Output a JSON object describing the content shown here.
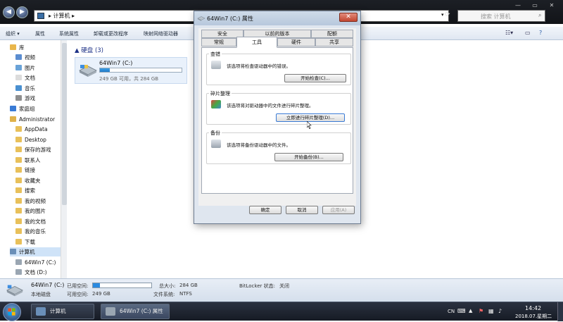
{
  "explorer": {
    "address": "▸ 计算机 ▸",
    "search_placeholder": "搜索 计算机",
    "toolbar": [
      "组织 ▾",
      "属性",
      "系统属性",
      "卸载或更改程序",
      "映射网络驱动器"
    ],
    "nav_items": [
      {
        "label": "库",
        "icon": "library-icon",
        "color": "#e9b64b"
      },
      {
        "label": "视频",
        "icon": "video-icon",
        "color": "#5b8dd0"
      },
      {
        "label": "图片",
        "icon": "picture-icon",
        "color": "#6aa3d8"
      },
      {
        "label": "文档",
        "icon": "document-icon",
        "color": "#dcdcdc"
      },
      {
        "label": "音乐",
        "icon": "music-icon",
        "color": "#4a90d0"
      },
      {
        "label": "游戏",
        "icon": "games-icon",
        "color": "#8f8f8f"
      },
      {
        "label": "家庭组",
        "icon": "homegroup-icon",
        "color": "#3a7bd5"
      },
      {
        "label": "Administrator",
        "icon": "user-folder-icon",
        "color": "#e0b24a"
      },
      {
        "label": "AppData",
        "icon": "folder-icon",
        "color": "#e8c05a"
      },
      {
        "label": "Desktop",
        "icon": "folder-icon",
        "color": "#e8c05a"
      },
      {
        "label": "保存的游戏",
        "icon": "folder-icon",
        "color": "#e8c05a"
      },
      {
        "label": "联系人",
        "icon": "folder-icon",
        "color": "#e8c05a"
      },
      {
        "label": "链接",
        "icon": "folder-icon",
        "color": "#e8c05a"
      },
      {
        "label": "收藏夹",
        "icon": "folder-icon",
        "color": "#e8c05a"
      },
      {
        "label": "搜索",
        "icon": "folder-icon",
        "color": "#e8c05a"
      },
      {
        "label": "我的视频",
        "icon": "folder-icon",
        "color": "#e8c05a"
      },
      {
        "label": "我的图片",
        "icon": "folder-icon",
        "color": "#e8c05a"
      },
      {
        "label": "我的文档",
        "icon": "folder-icon",
        "color": "#e8c05a"
      },
      {
        "label": "我的音乐",
        "icon": "folder-icon",
        "color": "#e8c05a"
      },
      {
        "label": "下载",
        "icon": "folder-icon",
        "color": "#e8c05a"
      },
      {
        "label": "计算机",
        "icon": "computer-icon",
        "color": "#6a8fb8"
      },
      {
        "label": "64Win7  (C:)",
        "icon": "drive-icon",
        "color": "#9aa6b2"
      },
      {
        "label": "文档 (D:)",
        "icon": "drive-icon",
        "color": "#9aa6b2"
      }
    ],
    "group_title": "▲ 硬盘 (3)",
    "drive": {
      "name": "64Win7  (C:)",
      "space": "249 GB 可用，共 284 GB",
      "used_fraction": 0.12
    },
    "details": {
      "name": "64Win7  (C:)",
      "used_label": "已用空间:",
      "free_label": "可用空间:",
      "free": "249 GB",
      "type": "本地磁盘",
      "total_label": "总大小:",
      "total": "284 GB",
      "fs_label": "文件系统:",
      "fs": "NTFS",
      "bitlocker_label": "BitLocker 状态:",
      "bitlocker": "关闭",
      "used_fraction": 0.12
    }
  },
  "taskbar": {
    "items": [
      "计算机",
      "64Win7  (C:) 属性"
    ],
    "lang": "CN",
    "time": "14:42",
    "date": "2018.07.星期二"
  },
  "dialog": {
    "title": "64Win7 (C:) 属性",
    "close": "✕",
    "tabs_row1": [
      "安全",
      "以前的版本",
      "配额"
    ],
    "tabs_row2": [
      "常规",
      "工具",
      "硬件",
      "共享"
    ],
    "active_tab": "工具",
    "groups": [
      {
        "label": "查错",
        "text": "该选项将检查驱动器中的错误。",
        "button": "开始检查(C)..."
      },
      {
        "label": "碎片整理",
        "text": "该选项将对驱动器中的文件进行碎片整理。",
        "button": "立即进行碎片整理(D)..."
      },
      {
        "label": "备份",
        "text": "该选项将备份驱动器中的文件。",
        "button": "开始备份(B)..."
      }
    ],
    "ok": "确定",
    "cancel": "取消",
    "apply": "应用(A)"
  },
  "colors": {
    "accent": "#1f79c8",
    "group_title": "#1e3287"
  }
}
